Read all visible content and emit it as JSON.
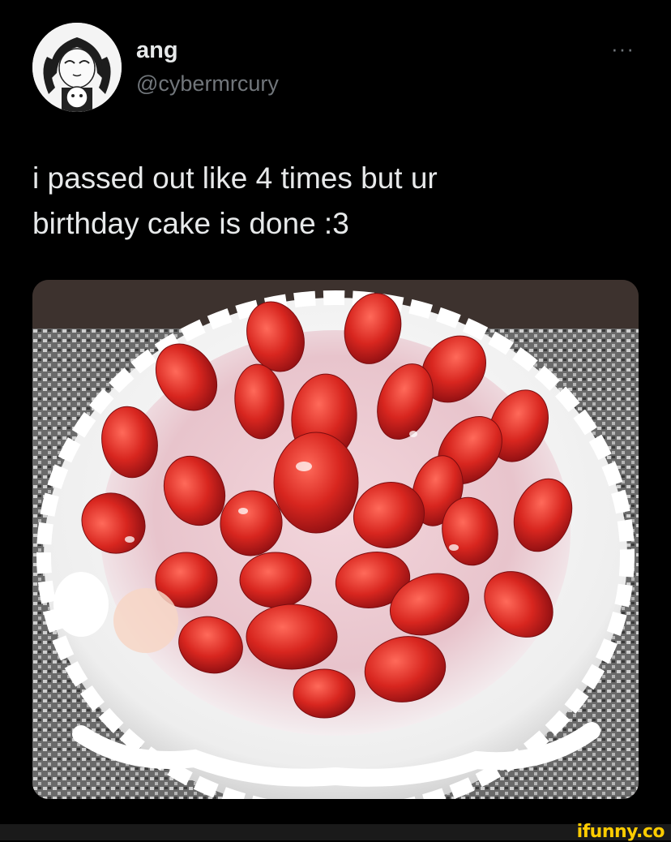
{
  "tweet": {
    "display_name": "ang",
    "handle": "@cybermrcury",
    "more_label": "···",
    "text_line1": "i passed out like 4 times but ur",
    "text_line2": "birthday cake is done :3"
  },
  "watermark": "ifunny.co",
  "colors": {
    "background": "#000000",
    "text": "#e7e9ea",
    "muted": "#71767b",
    "watermark": "#ffcc00"
  }
}
